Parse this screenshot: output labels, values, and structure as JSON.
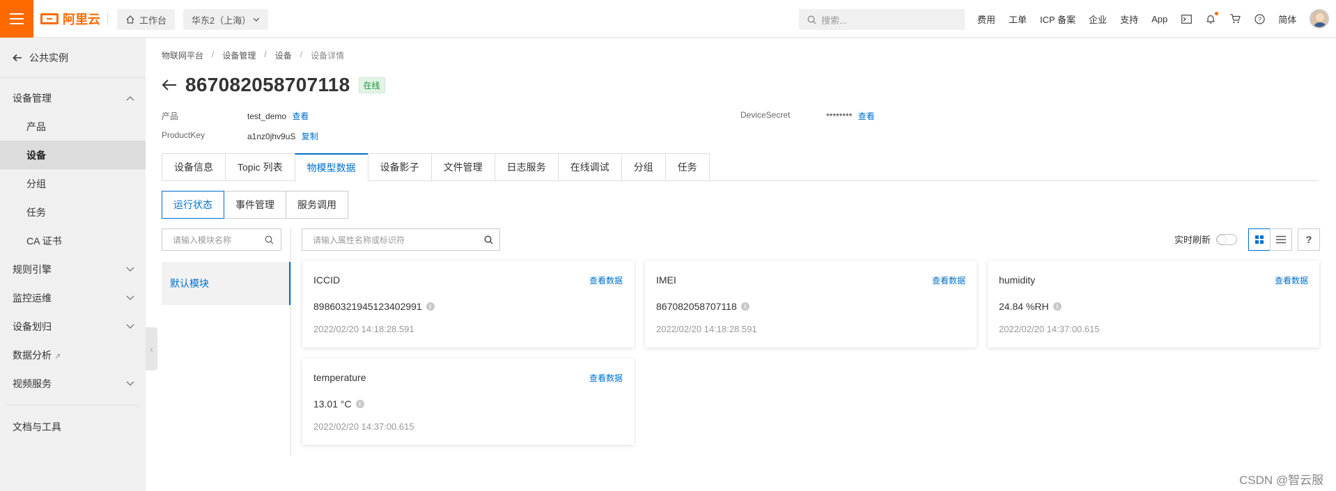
{
  "topbar": {
    "brand": "阿里云",
    "workbench": "工作台",
    "region": "华东2（上海）",
    "search_placeholder": "搜索...",
    "nav": [
      "费用",
      "工单",
      "ICP 备案",
      "企业",
      "支持",
      "App"
    ],
    "lang": "简体",
    "accent": "#ff6a00"
  },
  "sidebar": {
    "back": "公共实例",
    "items": [
      {
        "label": "设备管理"
      },
      {
        "label": "产品"
      },
      {
        "label": "设备"
      },
      {
        "label": "分组"
      },
      {
        "label": "任务"
      },
      {
        "label": "CA 证书"
      },
      {
        "label": "规则引擎"
      },
      {
        "label": "监控运维"
      },
      {
        "label": "设备划归"
      },
      {
        "label": "数据分析"
      },
      {
        "label": "视频服务"
      },
      {
        "label": "文档与工具"
      }
    ]
  },
  "breadcrumb": [
    "物联网平台",
    "设备管理",
    "设备",
    "设备详情"
  ],
  "device": {
    "name": "867082058707118",
    "status": "在线",
    "product_label": "产品",
    "product_value": "test_demo",
    "view": "查看",
    "productkey_label": "ProductKey",
    "productkey_value": "a1nz0jhv9uS",
    "copy": "复制",
    "secret_label": "DeviceSecret",
    "secret_value": "********"
  },
  "tabs": [
    "设备信息",
    "Topic 列表",
    "物模型数据",
    "设备影子",
    "文件管理",
    "日志服务",
    "在线调试",
    "分组",
    "任务"
  ],
  "subtabs": [
    "运行状态",
    "事件管理",
    "服务调用"
  ],
  "module_search_placeholder": "请输入模块名称",
  "module": "默认模块",
  "prop_search_placeholder": "请输入属性名称或标识符",
  "realtime_refresh": "实时刷新",
  "help": "?",
  "view_data": "查看数据",
  "cards": [
    {
      "name": "ICCID",
      "value": "89860321945123402991",
      "time": "2022/02/20 14:18:28.591"
    },
    {
      "name": "IMEI",
      "value": "867082058707118",
      "time": "2022/02/20 14:18:28.591"
    },
    {
      "name": "humidity",
      "value": "24.84 %RH",
      "time": "2022/02/20 14:37:00.615"
    },
    {
      "name": "temperature",
      "value": "13.01 °C",
      "time": "2022/02/20 14:37:00.615"
    }
  ],
  "watermark": "CSDN @智云服"
}
